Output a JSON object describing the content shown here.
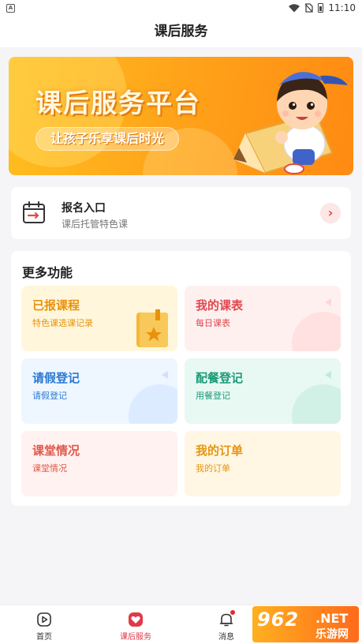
{
  "status_bar": {
    "time": "11:10",
    "left_badge": "A"
  },
  "header": {
    "title": "课后服务"
  },
  "banner": {
    "title": "课后服务平台",
    "subtitle": "让孩子乐享课后时光"
  },
  "register": {
    "title": "报名入口",
    "subtitle": "课后托管特色课",
    "arrow": "›"
  },
  "more": {
    "title": "更多功能",
    "tiles": [
      {
        "title": "已报课程",
        "subtitle": "特色课选课记录"
      },
      {
        "title": "我的课表",
        "subtitle": "每日课表"
      },
      {
        "title": "请假登记",
        "subtitle": "请假登记"
      },
      {
        "title": "配餐登记",
        "subtitle": "用餐登记"
      },
      {
        "title": "课堂情况",
        "subtitle": "课堂情况"
      },
      {
        "title": "我的订单",
        "subtitle": "我的订单"
      }
    ]
  },
  "tabbar": {
    "items": [
      {
        "label": "首页"
      },
      {
        "label": "课后服务"
      },
      {
        "label": "消息"
      }
    ]
  },
  "watermark": {
    "num": "962",
    "net": ".NET",
    "cn": "乐游网"
  },
  "colors": {
    "accent": "#e0394a",
    "banner_orange": "#ff9a15"
  }
}
